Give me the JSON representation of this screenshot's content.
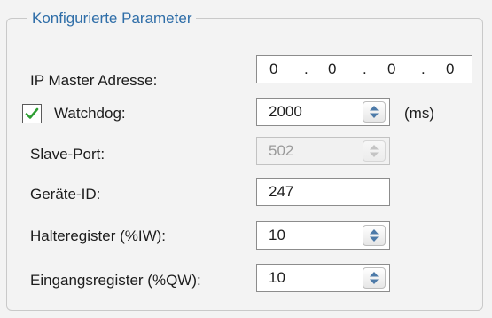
{
  "section": {
    "title": "Konfigurierte Parameter"
  },
  "ip_master": {
    "label": "IP Master Adresse:",
    "octets": [
      "0",
      "0",
      "0",
      "0"
    ],
    "separator": "."
  },
  "watchdog": {
    "label": "Watchdog:",
    "checked": true,
    "value": "2000",
    "unit": "(ms)"
  },
  "slave_port": {
    "label": "Slave-Port:",
    "value": "502",
    "enabled": false
  },
  "geraete_id": {
    "label": "Geräte-ID:",
    "value": "247"
  },
  "halteregister": {
    "label": "Halteregister (%IW):",
    "value": "10"
  },
  "eingangsregister": {
    "label": "Eingangsregister (%QW):",
    "value": "10"
  },
  "colors": {
    "title": "#2f6ea8",
    "checkmark": "#2e9e33",
    "spinner_arrows": "#4d7aa8"
  }
}
